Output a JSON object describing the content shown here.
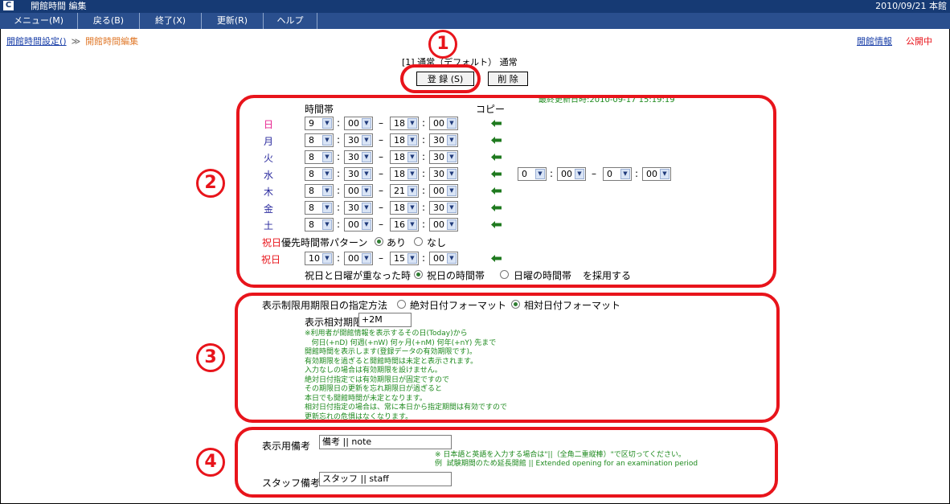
{
  "window": {
    "logo": "C",
    "title": "開館時間 編集",
    "date_location": "2010/09/21 本館"
  },
  "menu": [
    "メニュー(M)",
    "戻る(B)",
    "終了(X)",
    "更新(R)",
    "ヘルプ"
  ],
  "breadcrumb": {
    "parent": "開館時間設定()",
    "sep": "≫",
    "current": "開館時間編集"
  },
  "top_right": {
    "info_link": "開館情報",
    "status": "公開中"
  },
  "header": {
    "label": "[1] 通常（デフォルト） 通常"
  },
  "buttons": {
    "register": "登 録 (S)",
    "delete": "削 除"
  },
  "last_updated": "最終更新日時:2010-09-17 15:19:19",
  "annotations": {
    "one": "1",
    "two": "2",
    "three": "3",
    "four": "4"
  },
  "schedule": {
    "col_time": "時間帯",
    "col_copy": "コピー",
    "rows": [
      {
        "day": "日",
        "color": "#e8238f",
        "sh": "9",
        "sm": "00",
        "eh": "18",
        "em": "00"
      },
      {
        "day": "月",
        "color": "#2a2a9e",
        "sh": "8",
        "sm": "30",
        "eh": "18",
        "em": "30"
      },
      {
        "day": "火",
        "color": "#2a2a9e",
        "sh": "8",
        "sm": "30",
        "eh": "18",
        "em": "30"
      },
      {
        "day": "水",
        "color": "#2a2a9e",
        "sh": "8",
        "sm": "30",
        "eh": "18",
        "em": "30"
      },
      {
        "day": "木",
        "color": "#2a2a9e",
        "sh": "8",
        "sm": "00",
        "eh": "21",
        "em": "00"
      },
      {
        "day": "金",
        "color": "#2a2a9e",
        "sh": "8",
        "sm": "30",
        "eh": "18",
        "em": "30"
      },
      {
        "day": "土",
        "color": "#2a2a9e",
        "sh": "8",
        "sm": "00",
        "eh": "16",
        "em": "00"
      }
    ],
    "extra": {
      "sh": "0",
      "sm": "00",
      "eh": "0",
      "em": "00"
    },
    "holiday_pattern": {
      "label_red": "祝日",
      "label": "優先時間帯パターン",
      "yes": "あり",
      "no": "なし"
    },
    "holiday_row": {
      "day": "祝日",
      "sh": "10",
      "sm": "00",
      "eh": "15",
      "em": "00"
    },
    "overlap": {
      "label": "祝日と日曜が重なった時",
      "opt1": "祝日の時間帯",
      "opt2": "日曜の時間帯",
      "suffix": "を採用する"
    },
    "colon": ":",
    "dash": "–",
    "arrow": "▼"
  },
  "limit": {
    "label": "表示制限用期限日の指定方法",
    "opt_abs": "絶対日付フォーマット",
    "opt_rel": "相対日付フォーマット",
    "rel_label": "表示相対期限日",
    "rel_value": "+2M",
    "note": "※利用者が開館情報を表示するその日(Today)から\n   何日(+nD) 何週(+nW) 何ヶ月(+nM) 何年(+nY) 先まで\n開館時間を表示します(登録データの有効期限です)。\n有効期限を過ぎると開館時間は未定と表示されます。\n入力なしの場合は有効期限を設けません。\n絶対日付指定では有効期限日が固定ですので\nその期限日の更新を忘れ期限日が過ぎると\n本日でも開館時間が未定となります。\n相対日付指定の場合は、常に本日から指定期間は有効ですので\n更新忘れの危惧はなくなります。"
  },
  "remarks": {
    "display_label": "表示用備考",
    "display_value": "備考 || note",
    "note": "※ 日本語と英語を入力する場合は\"||（全角二重縦棒）\"で区切ってください。\n例  試験期間のため延長開館 || Extended opening for an examination period",
    "staff_label": "スタッフ備考",
    "staff_value": "スタッフ || staff"
  },
  "colors": {
    "annotation_red": "#e8141b",
    "title_bar": "#163a74",
    "menu_bar": "#2a4f8e",
    "note_green": "#1e8a1e"
  }
}
